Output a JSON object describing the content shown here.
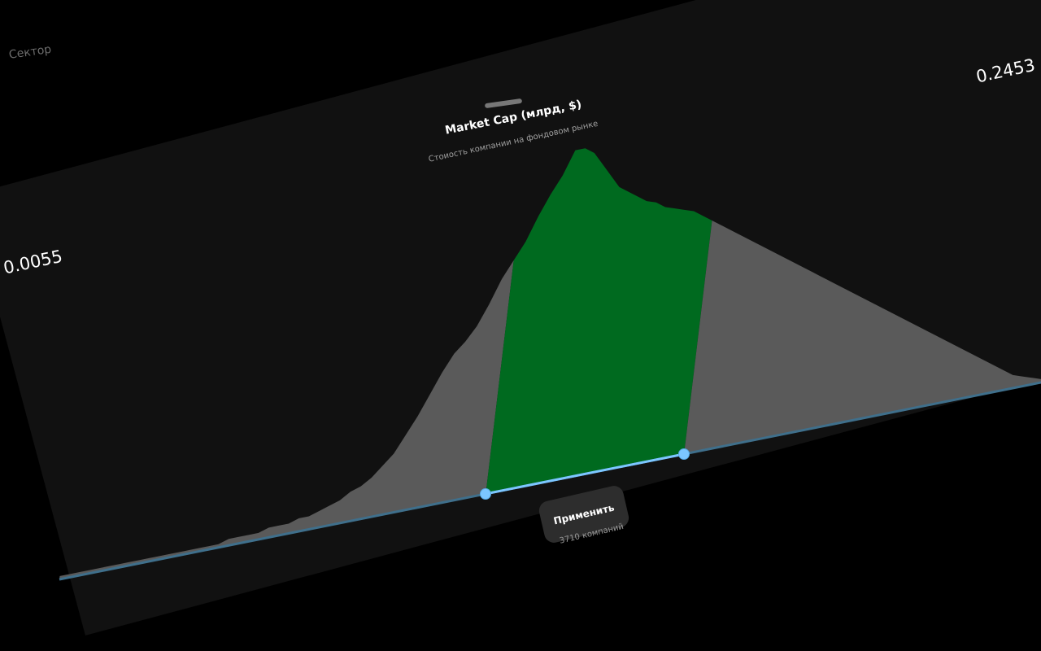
{
  "background_section": {
    "label": "Сектор"
  },
  "filter": {
    "title": "Market Cap (млрд, $)",
    "subtitle": "Стоиость компании на фондовом рынке",
    "range_min": "0.0055",
    "range_max": "0.2453",
    "apply_label": "Применить",
    "result_count": "3710 компаний",
    "selected_fraction": [
      0.43,
      0.64
    ]
  },
  "histogram": {
    "values": [
      1,
      1,
      1,
      1,
      1,
      1,
      1,
      1,
      1,
      1,
      1,
      1,
      1,
      1,
      1,
      1,
      1,
      2,
      2,
      2,
      2,
      3,
      3,
      3,
      4,
      4,
      5,
      6,
      7,
      9,
      10,
      12,
      15,
      18,
      23,
      28,
      34,
      40,
      45,
      48,
      52,
      58,
      65,
      70,
      75,
      82,
      88,
      93,
      100,
      100,
      98,
      94,
      90,
      86,
      84,
      82,
      80,
      79,
      77,
      76,
      75,
      74,
      72,
      70,
      68,
      66,
      64,
      62,
      60,
      58,
      56,
      54,
      52,
      50,
      48,
      46,
      44,
      42,
      40,
      38,
      36,
      34,
      32,
      30,
      28,
      26,
      24,
      22,
      20,
      18,
      16,
      14,
      12,
      10,
      8,
      6,
      4,
      3,
      2,
      1
    ],
    "selected_color": "#006a1f",
    "unselected_color": "#5a5a5a",
    "track_color": "#3f6f8b",
    "selected_track_color": "#7cc6ff"
  }
}
